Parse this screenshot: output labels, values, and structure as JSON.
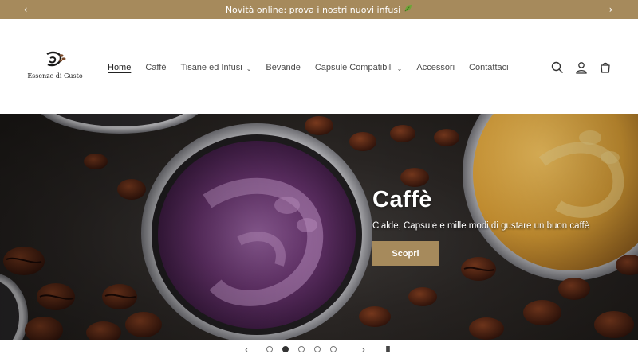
{
  "announcement": {
    "text": "Novità online: prova i nostri nuovi infusi",
    "leaf_icon": "leaf-icon",
    "prev_icon": "chevron-left-icon",
    "next_icon": "chevron-right-icon"
  },
  "logo": {
    "text": "Essenze di Gusto",
    "icon": "coffee-cup-logo-icon"
  },
  "nav": {
    "items": [
      {
        "label": "Home",
        "active": true,
        "has_dropdown": false
      },
      {
        "label": "Caffè",
        "active": false,
        "has_dropdown": false
      },
      {
        "label": "Tisane ed Infusi",
        "active": false,
        "has_dropdown": true
      },
      {
        "label": "Bevande",
        "active": false,
        "has_dropdown": false
      },
      {
        "label": "Capsule Compatibili",
        "active": false,
        "has_dropdown": true
      },
      {
        "label": "Accessori",
        "active": false,
        "has_dropdown": false
      },
      {
        "label": "Contattaci",
        "active": false,
        "has_dropdown": false
      }
    ],
    "dropdown_icon": "chevron-down-icon"
  },
  "header_icons": [
    "search-icon",
    "user-icon",
    "cart-icon"
  ],
  "hero": {
    "title": "Caffè",
    "subtitle": "Cialde, Capsule e mille modi di gustare un buon caffè",
    "button_label": "Scopri"
  },
  "slider": {
    "slide_count": 5,
    "active_index": 1,
    "prev_symbol": "‹",
    "next_symbol": "›",
    "pause_symbol": "II"
  },
  "colors": {
    "accent": "#a68a5c",
    "announcement_bg": "#a68a5c",
    "capsule_purple": "#5a2d5f",
    "capsule_gold": "#d9a43a",
    "coffee_bean": "#4a2414"
  }
}
